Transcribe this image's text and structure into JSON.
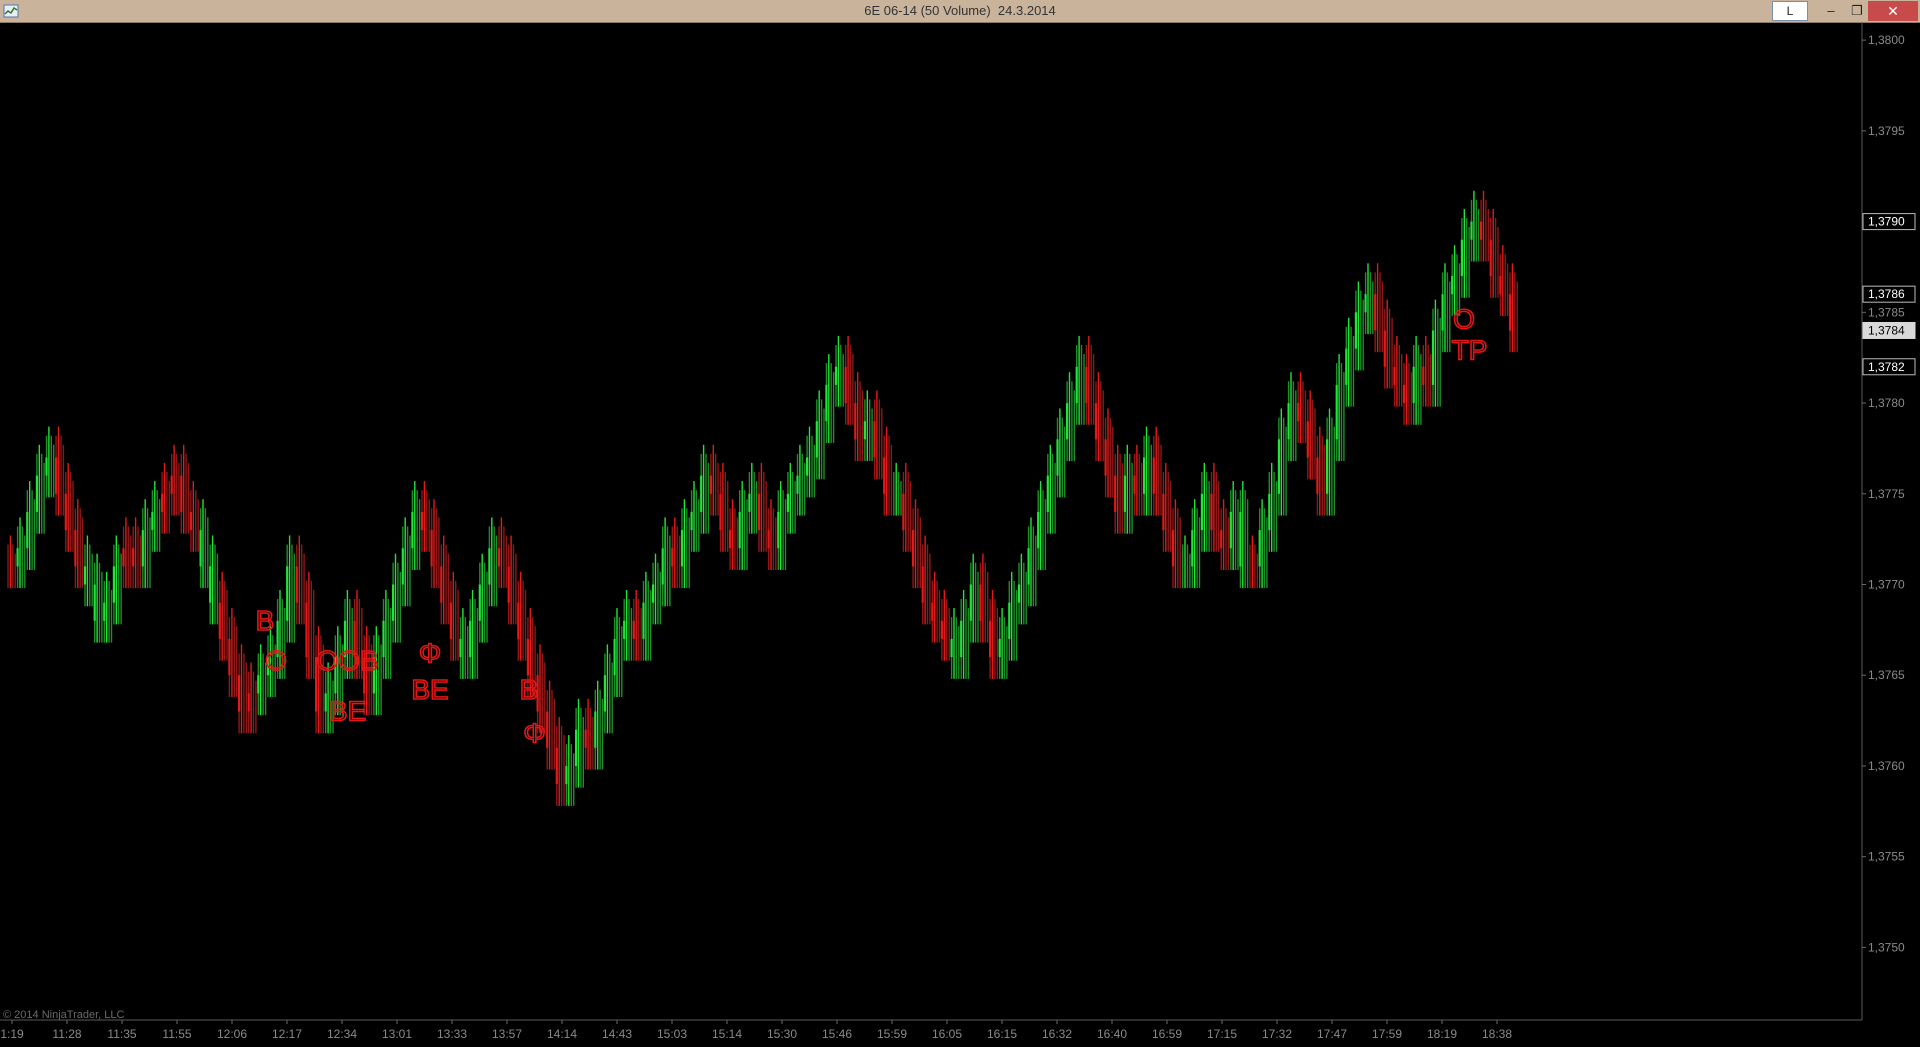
{
  "window": {
    "title": "6E 06-14 (50 Volume)  24.3.2014",
    "layout_button": "L",
    "minimize_glyph": "–",
    "restore_glyph": "❐",
    "close_glyph": "✕"
  },
  "colors": {
    "background": "#000000",
    "up_bar": "#22e33a",
    "up_bar_dim": "#1e8f28",
    "down_bar": "#e41a1a",
    "down_bar_dim": "#8f1818",
    "axis_text": "#8a8a8a",
    "annotation": "#e41616"
  },
  "copyright": "© 2014 NinjaTrader, LLC",
  "chart_data": {
    "type": "line",
    "title": "",
    "xlabel": "",
    "ylabel": "",
    "ylim": [
      1.3746,
      1.3801
    ],
    "y_ticks": [
      {
        "value": 1.38,
        "label": "1,3800"
      },
      {
        "value": 1.3795,
        "label": "1,3795"
      },
      {
        "value": 1.379,
        "label": "1,3790"
      },
      {
        "value": 1.3785,
        "label": "1,3785"
      },
      {
        "value": 1.378,
        "label": "1,3780"
      },
      {
        "value": 1.3775,
        "label": "1,3775"
      },
      {
        "value": 1.377,
        "label": "1,3770"
      },
      {
        "value": 1.3765,
        "label": "1,3765"
      },
      {
        "value": 1.376,
        "label": "1,3760"
      },
      {
        "value": 1.3755,
        "label": "1,3755"
      },
      {
        "value": 1.375,
        "label": "1,3750"
      }
    ],
    "price_markers": [
      {
        "value": 1.379,
        "label": "1,3790",
        "style": "box"
      },
      {
        "value": 1.3786,
        "label": "1,3786",
        "style": "box"
      },
      {
        "value": 1.3784,
        "label": "1,3784",
        "style": "filled"
      },
      {
        "value": 1.3782,
        "label": "1,3782",
        "style": "box"
      }
    ],
    "x_ticks": [
      "1:19",
      "11:28",
      "11:35",
      "11:55",
      "12:06",
      "12:17",
      "12:34",
      "13:01",
      "13:33",
      "13:57",
      "14:14",
      "14:43",
      "15:03",
      "15:14",
      "15:30",
      "15:46",
      "15:59",
      "16:05",
      "16:15",
      "16:32",
      "16:40",
      "16:59",
      "17:15",
      "17:32",
      "17:47",
      "17:59",
      "18:19",
      "18:38"
    ],
    "series": [
      {
        "values": [
          1.3771,
          1.3772,
          1.3774,
          1.3776,
          1.3777,
          1.3775,
          1.3773,
          1.3771,
          1.377,
          1.3768,
          1.3769,
          1.3771,
          1.3772,
          1.3771,
          1.3773,
          1.3774,
          1.3775,
          1.3776,
          1.3774,
          1.3773,
          1.3771,
          1.3769,
          1.3767,
          1.3765,
          1.3763,
          1.3764,
          1.3765,
          1.3766,
          1.3768,
          1.3771,
          1.3769,
          1.3766,
          1.3763,
          1.3764,
          1.3766,
          1.3768,
          1.3766,
          1.3764,
          1.3766,
          1.3768,
          1.377,
          1.3772,
          1.3774,
          1.3773,
          1.3771,
          1.3769,
          1.3767,
          1.3766,
          1.3768,
          1.377,
          1.3772,
          1.3771,
          1.3769,
          1.3767,
          1.3765,
          1.3763,
          1.3761,
          1.3759,
          1.376,
          1.3762,
          1.3761,
          1.3763,
          1.3765,
          1.3767,
          1.3768,
          1.3767,
          1.3769,
          1.377,
          1.3772,
          1.3771,
          1.3773,
          1.3774,
          1.3776,
          1.3775,
          1.3773,
          1.3772,
          1.3774,
          1.3775,
          1.3773,
          1.3772,
          1.3774,
          1.3775,
          1.3776,
          1.3777,
          1.3779,
          1.3781,
          1.3782,
          1.378,
          1.3778,
          1.3779,
          1.3777,
          1.3775,
          1.3775,
          1.3773,
          1.3771,
          1.3769,
          1.3768,
          1.3767,
          1.3766,
          1.3768,
          1.377,
          1.3768,
          1.3766,
          1.3767,
          1.3769,
          1.377,
          1.3772,
          1.3774,
          1.3776,
          1.3778,
          1.378,
          1.3782,
          1.378,
          1.3778,
          1.3776,
          1.3774,
          1.3776,
          1.3775,
          1.3777,
          1.3775,
          1.3773,
          1.3771,
          1.3771,
          1.3773,
          1.3775,
          1.3773,
          1.3772,
          1.3774,
          1.3771,
          1.3771,
          1.3773,
          1.3775,
          1.3778,
          1.378,
          1.3779,
          1.3777,
          1.3775,
          1.3778,
          1.3781,
          1.3783,
          1.3785,
          1.3786,
          1.3784,
          1.3782,
          1.3781,
          1.378,
          1.3782,
          1.3781,
          1.3784,
          1.3786,
          1.3787,
          1.3789,
          1.379,
          1.3789,
          1.3787,
          1.3786,
          1.3784
        ],
        "colors": [
          "d",
          "u",
          "u",
          "u",
          "u",
          "d",
          "d",
          "d",
          "u",
          "u",
          "u",
          "u",
          "d",
          "d",
          "u",
          "u",
          "d",
          "d",
          "d",
          "d",
          "u",
          "u",
          "d",
          "d",
          "d",
          "d",
          "u",
          "u",
          "u",
          "u",
          "d",
          "d",
          "d",
          "u",
          "u",
          "u",
          "d",
          "d",
          "u",
          "u",
          "u",
          "u",
          "u",
          "d",
          "d",
          "d",
          "d",
          "u",
          "u",
          "u",
          "u",
          "d",
          "d",
          "d",
          "d",
          "d",
          "d",
          "d",
          "u",
          "u",
          "d",
          "u",
          "u",
          "u",
          "u",
          "d",
          "u",
          "u",
          "u",
          "d",
          "u",
          "u",
          "u",
          "d",
          "d",
          "d",
          "u",
          "u",
          "d",
          "d",
          "u",
          "u",
          "u",
          "u",
          "u",
          "u",
          "u",
          "d",
          "d",
          "u",
          "d",
          "d",
          "u",
          "d",
          "d",
          "d",
          "d",
          "d",
          "u",
          "u",
          "u",
          "d",
          "d",
          "u",
          "u",
          "u",
          "u",
          "u",
          "u",
          "u",
          "u",
          "u",
          "d",
          "d",
          "d",
          "d",
          "u",
          "d",
          "u",
          "d",
          "d",
          "d",
          "u",
          "u",
          "u",
          "d",
          "d",
          "u",
          "u",
          "d",
          "u",
          "u",
          "u",
          "u",
          "d",
          "d",
          "d",
          "u",
          "u",
          "u",
          "u",
          "u",
          "d",
          "d",
          "d",
          "d",
          "u",
          "d",
          "u",
          "u",
          "u",
          "u",
          "u",
          "d",
          "d",
          "d",
          "d"
        ]
      }
    ],
    "annotations": [
      {
        "text": "B",
        "at_time_index": 4.6,
        "price": 1.37675
      },
      {
        "text": "O",
        "at_time_index": 4.8,
        "price": 1.37653
      },
      {
        "text": "OOB",
        "at_time_index": 6.1,
        "price": 1.37653
      },
      {
        "text": "BE",
        "at_time_index": 6.1,
        "price": 1.37625
      },
      {
        "text": "Φ",
        "at_time_index": 7.6,
        "price": 1.37657
      },
      {
        "text": "BE",
        "at_time_index": 7.6,
        "price": 1.37637
      },
      {
        "text": "B",
        "at_time_index": 9.4,
        "price": 1.37637
      },
      {
        "text": "Φ",
        "at_time_index": 9.5,
        "price": 1.37613
      },
      {
        "text": "O",
        "at_time_index": 26.4,
        "price": 1.37841
      },
      {
        "text": "TP",
        "at_time_index": 26.5,
        "price": 1.37824
      }
    ]
  }
}
